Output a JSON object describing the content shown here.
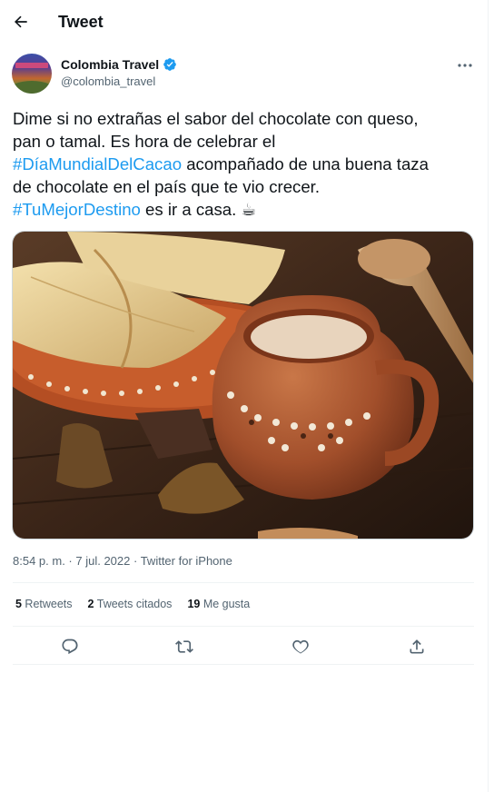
{
  "header": {
    "title": "Tweet",
    "back_icon": "arrow-left-icon"
  },
  "author": {
    "name": "Colombia Travel",
    "handle": "@colombia_travel",
    "verified_icon": "verified-badge-icon",
    "verified_color": "#1d9bf0"
  },
  "tweet": {
    "line1": "Dime si no extrañas el sabor del chocolate con queso,",
    "line2": "pan o tamal. Es hora de celebrar el",
    "hashtag1": "#DíaMundialDelCacao",
    "line3_rest": " acompañado de una buena taza",
    "line4": "de chocolate en el país que te vio crecer.",
    "hashtag2": "#TuMejorDestino",
    "line5_rest": " es ir a casa. ",
    "emoji": "☕"
  },
  "meta": {
    "time": "8:54 p. m.",
    "sep1": " · ",
    "date": "7 jul. 2022",
    "sep2": " · ",
    "source": "Twitter for iPhone"
  },
  "stats": {
    "retweets_count": "5",
    "retweets_label": " Retweets",
    "quotes_count": "2",
    "quotes_label": " Tweets citados",
    "likes_count": "19",
    "likes_label": " Me gusta"
  },
  "actions": [
    "reply-icon",
    "retweet-icon",
    "like-icon",
    "share-icon"
  ],
  "colors": {
    "accent": "#1d9bf0",
    "text": "#0f1419",
    "secondary": "#536471",
    "border": "#eff3f4"
  }
}
